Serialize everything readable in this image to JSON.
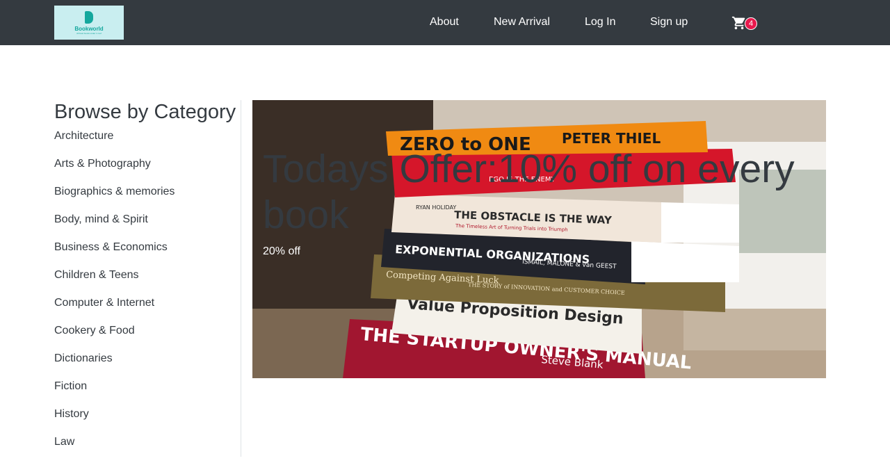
{
  "brand": {
    "name": "Bookworld",
    "tagline": "All best books under 1 roof"
  },
  "nav": {
    "links": [
      "About",
      "New Arrival",
      "Log In",
      "Sign up"
    ],
    "cart_icon": "shopping-cart-icon",
    "cart_count": "4"
  },
  "sidebar": {
    "title": "Browse by Category",
    "categories": [
      "Architecture",
      "Arts & Photography",
      "Biographics & memories",
      "Body, mind & Spirit",
      "Business & Economics",
      "Children & Teens",
      "Computer & Internet",
      "Cookery & Food",
      "Dictionaries",
      "Fiction",
      "History",
      "Law"
    ]
  },
  "hero": {
    "title": "Todays Offer:10% off on every book",
    "subtitle": "20% off",
    "image_alt": "Stack of books",
    "book_spines": [
      "ZERO to ONE",
      "PETER THIEL",
      "EGO IS THE ENEMY",
      "RYAN HOLIDAY",
      "THE OBSTACLE IS THE WAY",
      "The Timeless Art of Turning Trials into Triumph",
      "EXPONENTIAL ORGANIZATIONS",
      "ISMAIL, MALONE & van GEEST",
      "Competing Against Luck",
      "THE STORY of INNOVATION and CUSTOMER CHOICE",
      "Value Proposition Design",
      "THE STARTUP OWNER'S MANUAL",
      "Steve Blank"
    ]
  },
  "colors": {
    "navbar": "#343a40",
    "badge": "#e8194d",
    "logo_bg": "#c9eef0",
    "logo_accent": "#14a79d"
  }
}
